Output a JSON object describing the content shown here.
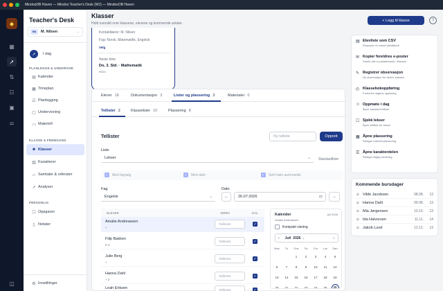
{
  "window": {
    "title": "MindooDB Haven — Mindoo Teacher's Desk (NO) — MindooDB Haven"
  },
  "brand": {
    "name_bold": "Teacher's",
    "name_rest": "Desk"
  },
  "user": {
    "initials": "MN",
    "name": "M. Nilsen"
  },
  "today": {
    "label": "I dag"
  },
  "sidebar": {
    "sections": [
      {
        "title": "PLANLEGGE & UNDERVISE",
        "items": [
          "Kalender",
          "Timeplan",
          "Planlegging",
          "Undervisning",
          "Materiell"
        ]
      },
      {
        "title": "KLASSE & FREMGANG",
        "items": [
          "Klasser",
          "Karakterer",
          "Samtaler & referater",
          "Analyser"
        ]
      },
      {
        "title": "PERSONLIG",
        "items": [
          "Oppgaver",
          "Notater"
        ]
      }
    ],
    "settings": "Innstillinger"
  },
  "header": {
    "title": "Klasser",
    "subtitle": "Hold oversikt over klassene, elevene og kommende avtaler.",
    "add_button": "+ Legg til klasse",
    "help": "?"
  },
  "class_card": {
    "contact": "Kontaktlærer: M. Nilsen",
    "subjects": "Fag: Norsk, Matematikk, Engelsk",
    "select": "Velg",
    "next_label": "Neste time",
    "next_value": "Do, 3. Std. · Mathematik",
    "room": "R203"
  },
  "tabs": [
    {
      "label": "Elever",
      "count": "18"
    },
    {
      "label": "Dokumentasjon",
      "count": "3"
    },
    {
      "label": "Lister og plassering",
      "count": "3"
    },
    {
      "label": "Materialer",
      "count": "0"
    }
  ],
  "subtabs": [
    {
      "label": "Tellister",
      "count": "2"
    },
    {
      "label": "Klasselister",
      "count": "10"
    },
    {
      "label": "Plassering",
      "count": "8"
    }
  ],
  "tellister": {
    "title": "Tellister",
    "new_placeholder": "Ny telliste",
    "create": "Opprett",
    "list_label": "Liste",
    "list_value": "Lekser",
    "standard": "Standardliste",
    "options": [
      "Med fagvalg",
      "Med dato",
      "Sett hake automatisk"
    ],
    "subject_label": "Fag",
    "subject_value": "Engelsk",
    "date_label": "Dato",
    "date_value": "26.07.2026",
    "columns": [
      "ELEVER",
      "VERDI",
      "KAL."
    ],
    "value_placeholder": "Tall/tekst",
    "students": [
      {
        "name": "Amalie Andreassen",
        "sub": "+"
      },
      {
        "name": "Filip Bakken",
        "sub": "Σ 3"
      },
      {
        "name": "Julie Berg",
        "sub": "+"
      },
      {
        "name": "Hanna Dahl",
        "sub": "+ 2"
      },
      {
        "name": "Leah Eriksen",
        "sub": "Σ 3"
      }
    ]
  },
  "calendar": {
    "title": "Kalender",
    "owner": "Amalie Andreassen",
    "month_hint": "juli 2026",
    "compact": "Kompakt visning",
    "month": "Juli",
    "year": "2026",
    "weekdays": [
      "Man",
      "Tir",
      "Ons",
      "Tor",
      "Fre",
      "Lør",
      "Søn"
    ],
    "weeks": [
      [
        "",
        "",
        "1",
        "2",
        "3",
        "4",
        "5"
      ],
      [
        "6",
        "7",
        "8",
        "9",
        "10",
        "11",
        "12"
      ],
      [
        "13",
        "14",
        "15",
        "16",
        "17",
        "18",
        "19"
      ],
      [
        "20",
        "21",
        "22",
        "23",
        "24",
        "25",
        "26"
      ]
    ],
    "selected": "26"
  },
  "actions": [
    {
      "icon": "▤",
      "title": "Elevliste som CSV",
      "sub": "Eksporter en enkel tekstfabell"
    },
    {
      "icon": "✉",
      "title": "Kopier foreldres e-poster",
      "sub": "Samle alle e-postadresser i klassen"
    },
    {
      "icon": "✎",
      "title": "Registrer observasjon",
      "sub": "Ny observasjon for denne klassen"
    },
    {
      "icon": "◴",
      "title": "Klassebokoppføring",
      "sub": "Forbered dagens oppføring"
    },
    {
      "icon": "☺",
      "title": "Oppmøte i dag",
      "sub": "Åpne standard telliste"
    },
    {
      "icon": "☐",
      "title": "Sjekk lekser",
      "sub": "Åpne tellliste for lekser"
    },
    {
      "icon": "▦",
      "title": "Åpne plassering",
      "sub": "Rediger rutenett-plassering"
    },
    {
      "icon": "☰",
      "title": "Åpne karakterdelen",
      "sub": "Rediger faglig vurdering"
    }
  ],
  "birthdays": {
    "title": "Kommende bursdager",
    "items": [
      {
        "name": "Vilde Jacobsen",
        "date": "08.08.",
        "age": "13"
      },
      {
        "name": "Hanna Dahl",
        "date": "09.08.",
        "age": "13"
      },
      {
        "name": "Mia Jørgensen",
        "date": "10.10.",
        "age": "13"
      },
      {
        "name": "Ida Halvorsen",
        "date": "11.11.",
        "age": "14"
      },
      {
        "name": "Jakob Lund",
        "date": "12.12.",
        "age": "13"
      }
    ]
  }
}
